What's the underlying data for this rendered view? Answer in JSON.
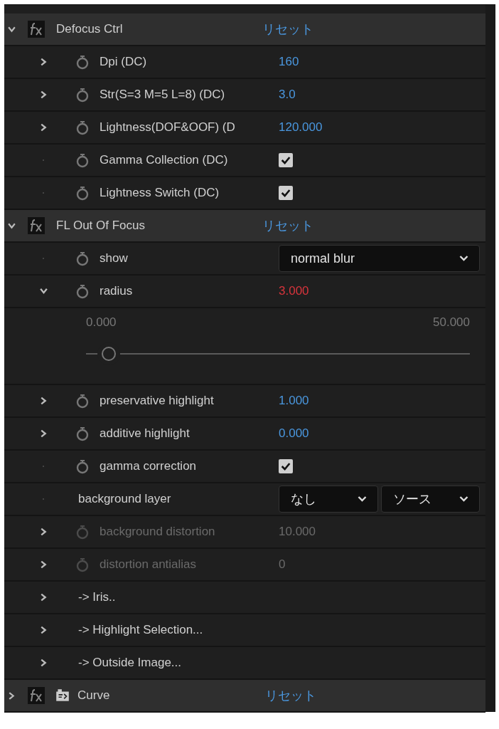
{
  "effects": [
    {
      "name": "Defocus Ctrl",
      "expanded": true,
      "reset": "リセット",
      "layer_icon": false,
      "params": [
        {
          "kind": "number",
          "label": "Dpi (DC)",
          "expandable": true,
          "expanded": false,
          "stopwatch": true,
          "disabled": false,
          "expression": false,
          "value": "160"
        },
        {
          "kind": "number",
          "label": "Str(S=3 M=5 L=8) (DC)",
          "expandable": true,
          "expanded": false,
          "stopwatch": true,
          "disabled": false,
          "expression": false,
          "value": "3.0"
        },
        {
          "kind": "number",
          "label": "Lightness(DOF&OOF) (D",
          "expandable": true,
          "expanded": false,
          "stopwatch": true,
          "disabled": false,
          "expression": false,
          "value": "120.000"
        },
        {
          "kind": "checkbox",
          "label": "Gamma Collection (DC)",
          "expandable": false,
          "stopwatch": true,
          "disabled": false,
          "checked": true
        },
        {
          "kind": "checkbox",
          "label": "Lightness Switch (DC)",
          "expandable": false,
          "stopwatch": true,
          "disabled": false,
          "checked": true
        }
      ]
    },
    {
      "name": "FL Out Of Focus",
      "expanded": true,
      "reset": "リセット",
      "layer_icon": false,
      "params": [
        {
          "kind": "dropdown",
          "label": "show",
          "expandable": false,
          "stopwatch": true,
          "disabled": false,
          "options": [
            "normal blur"
          ]
        },
        {
          "kind": "number",
          "label": "radius",
          "expandable": true,
          "expanded": true,
          "stopwatch": true,
          "disabled": false,
          "expression": true,
          "value": "3.000",
          "slider": {
            "min": "0.000",
            "max": "50.000",
            "level": 0.06
          }
        },
        {
          "kind": "number",
          "label": "preservative highlight",
          "expandable": true,
          "expanded": false,
          "stopwatch": true,
          "disabled": false,
          "expression": false,
          "value": "1.000"
        },
        {
          "kind": "number",
          "label": "additive highlight",
          "expandable": true,
          "expanded": false,
          "stopwatch": true,
          "disabled": false,
          "expression": false,
          "value": "0.000"
        },
        {
          "kind": "checkbox",
          "label": "gamma correction",
          "expandable": false,
          "stopwatch": true,
          "disabled": false,
          "checked": true
        },
        {
          "kind": "dropdown",
          "label": "background layer",
          "expandable": false,
          "stopwatch": false,
          "disabled": false,
          "options": [
            "なし",
            "ソース"
          ]
        },
        {
          "kind": "number",
          "label": "background distortion",
          "expandable": true,
          "expanded": false,
          "stopwatch": true,
          "disabled": true,
          "expression": false,
          "value": "10.000"
        },
        {
          "kind": "number",
          "label": "distortion antialias",
          "expandable": true,
          "expanded": false,
          "stopwatch": true,
          "disabled": true,
          "expression": false,
          "value": "0"
        },
        {
          "kind": "group",
          "label": "-> Iris..",
          "expandable": true,
          "expanded": false,
          "stopwatch": false,
          "disabled": false
        },
        {
          "kind": "group",
          "label": "-> Highlight Selection...",
          "expandable": true,
          "expanded": false,
          "stopwatch": false,
          "disabled": false
        },
        {
          "kind": "group",
          "label": "-> Outside Image...",
          "expandable": true,
          "expanded": false,
          "stopwatch": false,
          "disabled": false
        }
      ]
    },
    {
      "name": "Curve",
      "expanded": false,
      "reset": "リセット",
      "layer_icon": true
    }
  ]
}
